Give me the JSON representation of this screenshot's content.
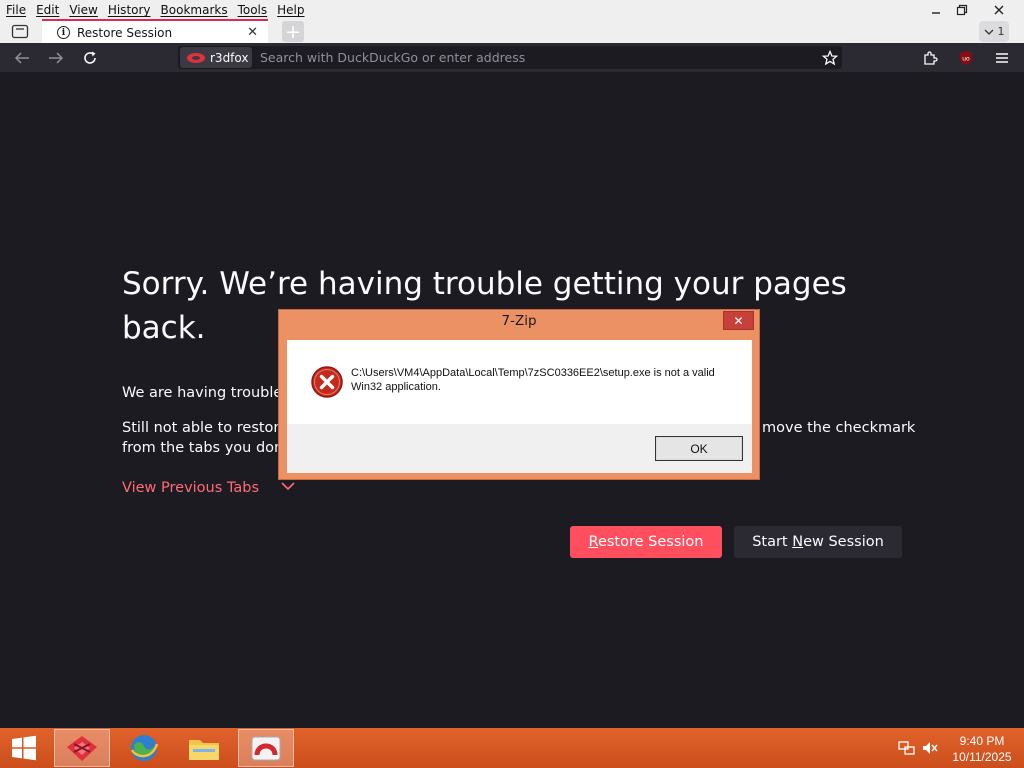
{
  "menubar": {
    "items": [
      "File",
      "Edit",
      "View",
      "History",
      "Bookmarks",
      "Tools",
      "Help"
    ]
  },
  "window_controls": {
    "minimize_icon": "minimize-icon",
    "restore_icon": "restore-icon",
    "close_icon": "close-icon"
  },
  "tab_overflow": {
    "count": "1"
  },
  "tab": {
    "title": "Restore Session"
  },
  "navbar": {
    "identity_label": "r3dfox",
    "search_placeholder": "Search with DuckDuckGo or enter address"
  },
  "page": {
    "headline": "Sorry. We’re having trouble getting your pages back.",
    "para1_visible": "We are having trouble r",
    "para2_line1_left": "Still not able to restore",
    "para2_line1_right": "move the checkmark",
    "para2_line2_left": "from the tabs you don’t",
    "view_previous_tabs": "View Previous Tabs",
    "restore_button": {
      "pre": "",
      "underlined": "R",
      "post": "estore Session"
    },
    "new_session_button": {
      "pre": "Start ",
      "underlined": "N",
      "post": "ew Session"
    }
  },
  "dialog": {
    "title": "7-Zip",
    "message": "C:\\Users\\VM4\\AppData\\Local\\Temp\\7zSC0336EE2\\setup.exe is not a valid Win32 application.",
    "ok_label": "OK"
  },
  "taskbar": {
    "clock_time": "9:40 PM",
    "clock_date": "10/11/2025"
  },
  "colors": {
    "page_bg": "#1c1b22",
    "accent_red": "#ff4f5e",
    "link_red": "#ff6a75",
    "dialog_frame": "#ec9163",
    "taskbar": "#d9571f"
  }
}
